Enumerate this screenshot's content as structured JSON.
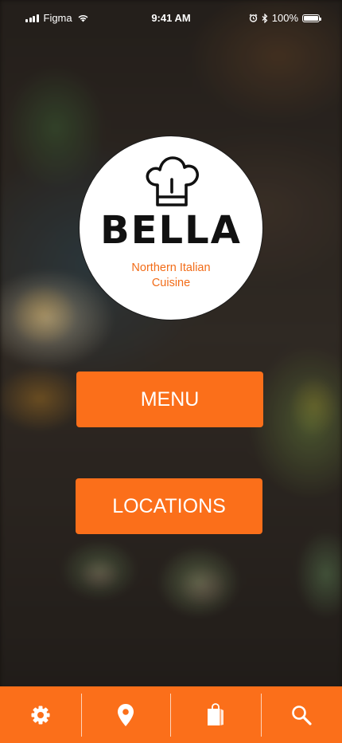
{
  "status_bar": {
    "carrier": "Figma",
    "time": "9:41 AM",
    "battery": "100%",
    "icons": [
      "signal-icon",
      "wifi-icon",
      "alarm-icon",
      "bluetooth-icon",
      "battery-icon"
    ]
  },
  "logo": {
    "icon": "chef-hat-icon",
    "name": "BELLA",
    "subtitle_line1": "Northern Italian",
    "subtitle_line2": "Cuisine"
  },
  "buttons": {
    "menu_label": "MENU",
    "locations_label": "LOCATIONS"
  },
  "tab_bar": {
    "items": [
      {
        "icon": "gear-icon"
      },
      {
        "icon": "location-pin-icon"
      },
      {
        "icon": "shopping-bag-icon"
      },
      {
        "icon": "search-icon"
      }
    ]
  },
  "colors": {
    "accent": "#fb6f1a",
    "subtitle": "#f26c18",
    "logo_text": "#111111",
    "white": "#ffffff"
  }
}
